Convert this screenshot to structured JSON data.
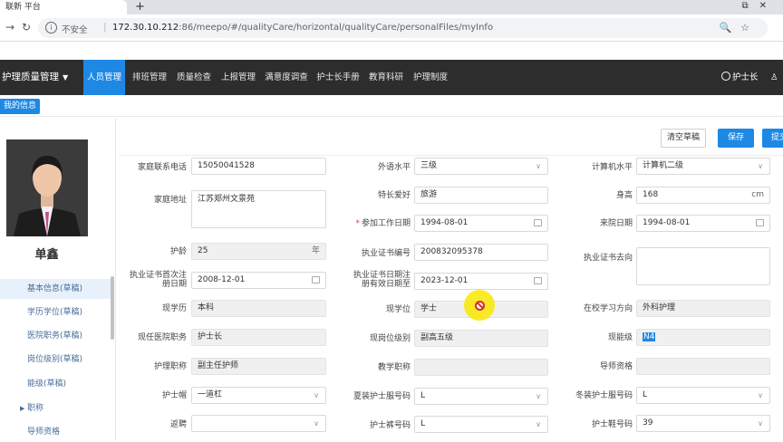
{
  "browser": {
    "tab_title": "联新 平台",
    "new_tab": "+",
    "insecure_label": "不安全",
    "url_host": "172.30.10.212",
    "url_rest": ":86/meepo/#/qualityCare/horizontal/qualityCare/personalFiles/myInfo"
  },
  "appnav": {
    "brand": "护理质量管理",
    "items": [
      "人员管理",
      "排班管理",
      "质量检查",
      "上报管理",
      "满意度调查",
      "护士长手册",
      "教育科研",
      "护理制度"
    ],
    "active_index": 0,
    "user": "护士长"
  },
  "page_tab": "我的信息",
  "sidebar": {
    "name": "单鑫",
    "items": [
      {
        "label": "基本信息",
        "status": "(草稿)"
      },
      {
        "label": "学历学位",
        "status": "(草稿)"
      },
      {
        "label": "医院职务",
        "status": "(草稿)"
      },
      {
        "label": "岗位级别",
        "status": "(草稿)"
      },
      {
        "label": "能级",
        "status": "(草稿)"
      },
      {
        "label": "职称",
        "status": ""
      },
      {
        "label": "导师资格",
        "status": ""
      }
    ]
  },
  "buttons": {
    "clear": "清空草稿",
    "save": "保存",
    "submit": "提交"
  },
  "form": {
    "home_phone": {
      "label": "家庭联系电话",
      "value": "15050041528"
    },
    "foreign_lang": {
      "label": "外语水平",
      "value": "三级"
    },
    "computer": {
      "label": "计算机水平",
      "value": "计算机二级"
    },
    "address": {
      "label": "家庭地址",
      "value": "江苏郑州文景苑"
    },
    "hobby": {
      "label": "特长爱好",
      "value": "旅游"
    },
    "height": {
      "label": "身高",
      "value": "168",
      "unit": "cm"
    },
    "work_start": {
      "label": "参加工作日期",
      "value": "1994-08-01"
    },
    "hospital_date": {
      "label": "来院日期",
      "value": "1994-08-01"
    },
    "nurse_age": {
      "label": "护龄",
      "value": "25",
      "unit": "年"
    },
    "license_no": {
      "label": "执业证书编号",
      "value": "200832095378"
    },
    "license_dest": {
      "label": "执业证书去向",
      "value": ""
    },
    "license_first": {
      "label": "执业证书首次注册日期",
      "value": "2008-12-01"
    },
    "license_valid": {
      "label": "执业证书日期注册有效日期至",
      "value": "2023-12-01"
    },
    "education": {
      "label": "现学历",
      "value": "本科"
    },
    "degree": {
      "label": "现学位",
      "value": "学士"
    },
    "study": {
      "label": "在校学习方向",
      "value": "外科护理"
    },
    "hospital_post": {
      "label": "现任医院职务",
      "value": "护士长"
    },
    "post_level": {
      "label": "现岗位级别",
      "value": "副高五级"
    },
    "ability_level": {
      "label": "现能级",
      "value": "N4"
    },
    "nursing_title": {
      "label": "护理职称",
      "value": "副主任护师"
    },
    "teaching_title": {
      "label": "教学职称",
      "value": ""
    },
    "mentor": {
      "label": "导师资格",
      "value": ""
    },
    "nurse_cap": {
      "label": "护士帽",
      "value": "一道杠"
    },
    "summer_size": {
      "label": "夏装护士服号码",
      "value": "L"
    },
    "winter_size": {
      "label": "冬装护士服号码",
      "value": "L"
    },
    "rehire": {
      "label": "返聘",
      "value": ""
    },
    "pants_size": {
      "label": "护士裤号码",
      "value": "L"
    },
    "shoe_size": {
      "label": "护士鞋号码",
      "value": "39"
    }
  }
}
